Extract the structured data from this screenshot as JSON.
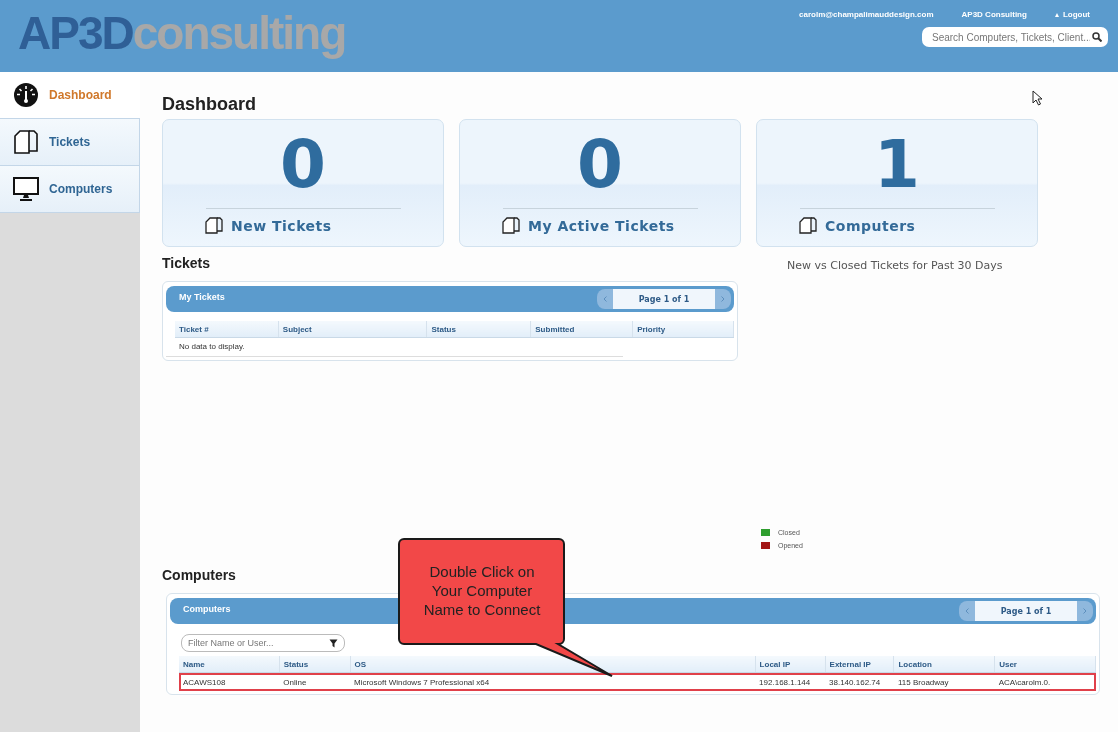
{
  "header": {
    "logo": {
      "initials": "AP3D",
      "word": "consulting"
    },
    "user_links": [
      {
        "label": "carolm@champalimauddesign.com",
        "kind": "text"
      },
      {
        "label": "AP3D Consulting",
        "kind": "text"
      },
      {
        "label": "Logout",
        "kind": "logout"
      }
    ],
    "search": {
      "placeholder": "Search Computers, Tickets, Client..."
    }
  },
  "sidebar": {
    "items": [
      {
        "label": "Dashboard",
        "kind": "gauge",
        "selected": true
      },
      {
        "label": "Tickets",
        "kind": "documents",
        "selected": false
      },
      {
        "label": "Computers",
        "kind": "monitor",
        "selected": false
      }
    ]
  },
  "page_title": "Dashboard",
  "stats": [
    {
      "value": "0",
      "label": "New Tickets"
    },
    {
      "value": "0",
      "label": "My Active Tickets"
    },
    {
      "value": "1",
      "label": "Computers"
    }
  ],
  "tickets": {
    "heading": "Tickets",
    "grid": {
      "title": "My Tickets",
      "pager": "Page 1 of 1",
      "columns": [
        "Ticket #",
        "Subject",
        "Status",
        "Submitted",
        "Priority"
      ],
      "empty_text": "No data to display."
    }
  },
  "chart": {
    "title": "New vs Closed Tickets for Past 30 Days",
    "legend": [
      {
        "label": "Closed",
        "color": "#2e9e2e"
      },
      {
        "label": "Opened",
        "color": "#a31515"
      }
    ]
  },
  "computers": {
    "heading": "Computers",
    "grid": {
      "title": "Computers",
      "pager": "Page 1 of 1",
      "filter": {
        "placeholder": "Filter Name or User..."
      },
      "columns": [
        "Name",
        "Status",
        "OS",
        "Local IP",
        "External IP",
        "Location",
        "User"
      ],
      "rows": [
        {
          "cells": [
            "ACAWS108",
            "Online",
            "Microsoft Windows 7 Professional x64",
            "192.168.1.144",
            "38.140.162.74",
            "115 Broadway",
            "ACA\\carolm.0."
          ],
          "highlighted": true
        }
      ]
    }
  },
  "callout": {
    "text": "Double Click on Your Computer Name to Connect"
  }
}
